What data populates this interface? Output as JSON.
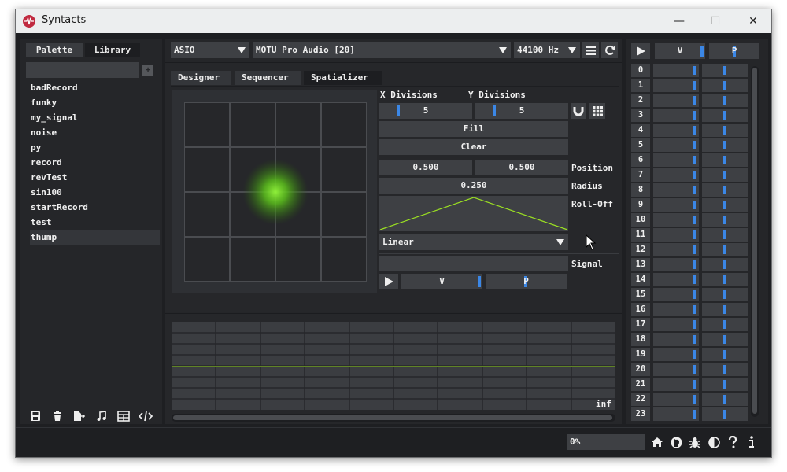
{
  "window": {
    "title": "Syntacts",
    "minimize_glyph": "—",
    "maximize_glyph": "☐",
    "close_glyph": "✕"
  },
  "left_panel": {
    "tabs": [
      "Palette",
      "Library"
    ],
    "active_tab": "Library",
    "search_value": "",
    "add_glyph": "+",
    "items": [
      "badRecord",
      "funky",
      "my_signal",
      "noise",
      "py",
      "record",
      "revTest",
      "sin100",
      "startRecord",
      "test",
      "thump"
    ],
    "selected_item": "thump",
    "toolbar_icons": [
      "save-icon",
      "trash-icon",
      "export-file-icon",
      "music-note-icon",
      "table-icon",
      "code-icon"
    ]
  },
  "audio_bar": {
    "driver": "ASIO",
    "device": "MOTU Pro Audio [20]",
    "sample_rate": "44100 Hz",
    "menu_icon": "hamburger-icon",
    "refresh_icon": "refresh-icon"
  },
  "center_tabs": {
    "items": [
      "Designer",
      "Sequencer",
      "Spatializer"
    ],
    "active": "Spatializer"
  },
  "spatializer": {
    "x_divisions_label": "X Divisions",
    "y_divisions_label": "Y Divisions",
    "x_divisions": "5",
    "y_divisions": "5",
    "x_divisions_fraction": 0.2,
    "y_divisions_fraction": 0.2,
    "fill_label": "Fill",
    "clear_label": "Clear",
    "position_x": "0.500",
    "position_y": "0.500",
    "position_label": "Position",
    "radius": "0.250",
    "radius_label": "Radius",
    "rolloff_label": "Roll-Off",
    "rolloff_type": "Linear",
    "signal_label": "Signal",
    "signal_value": "",
    "volume_label": "V",
    "pan_label": "P",
    "play_icon": "play-icon",
    "magnet_icon": "magnet-icon",
    "grid_icon": "grid-icon",
    "grid_color": "#4a4c50",
    "source_color": "#7cd62a"
  },
  "plot": {
    "end_label": "inf",
    "line_color": "#9be022"
  },
  "channels": {
    "play_icon": "play-icon",
    "volume_label": "V",
    "pan_label": "P",
    "numbers": [
      "0",
      "1",
      "2",
      "3",
      "4",
      "5",
      "6",
      "7",
      "8",
      "9",
      "10",
      "11",
      "12",
      "13",
      "14",
      "15",
      "16",
      "17",
      "18",
      "19",
      "20",
      "21",
      "22",
      "23"
    ]
  },
  "status_bar": {
    "progress": "0%",
    "icons": [
      "home-icon",
      "github-icon",
      "bug-icon",
      "theme-icon",
      "help-icon",
      "info-icon"
    ]
  },
  "colors": {
    "accent": "#3b87e6",
    "window_bg": "#1e1f22",
    "panel_bg": "#252629",
    "widget_bg": "#3e4044",
    "titlebar_bg": "#eceeef"
  }
}
